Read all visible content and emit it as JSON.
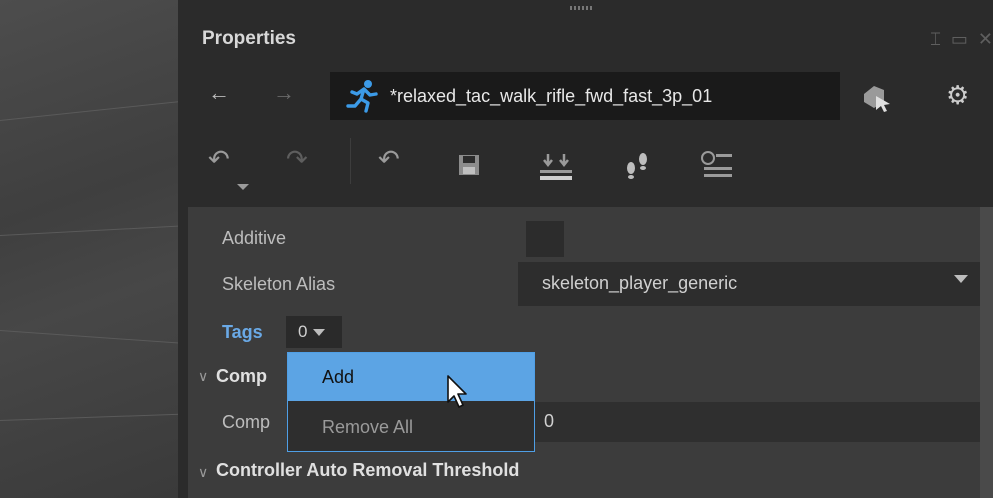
{
  "panel": {
    "title": "Properties",
    "window_controls": [
      "dock-icon",
      "maximize-icon",
      "close-icon"
    ]
  },
  "nav": {
    "back_icon": "arrow-left-icon",
    "forward_icon": "arrow-right-icon",
    "asset_icon": "running-figure-icon",
    "asset_name": "*relaxed_tac_walk_rifle_fwd_fast_3p_01",
    "tools": [
      "select-asset-icon",
      "settings-icon"
    ]
  },
  "toolbar": {
    "icons": [
      "undo-dropdown-icon",
      "redo-icon",
      "revert-icon",
      "save-icon",
      "import-icon",
      "footsteps-icon",
      "search-list-icon"
    ]
  },
  "properties": {
    "additive_label": "Additive",
    "additive_checked": false,
    "skeleton_alias_label": "Skeleton Alias",
    "skeleton_alias_value": "skeleton_player_generic",
    "tags_label": "Tags",
    "tags_count": "0",
    "section1_label": "Comp",
    "field1_label": "Comp",
    "field1_value": "0",
    "section2_label": "Controller Auto Removal Threshold"
  },
  "tags_menu": {
    "items": [
      {
        "label": "Add",
        "highlighted": true
      },
      {
        "label": "Remove All",
        "highlighted": false
      }
    ]
  },
  "colors": {
    "accent": "#5ca4e4",
    "tags_label": "#6aa9e6",
    "panel_bg": "#2b2b2b",
    "props_bg": "#3c3c3c"
  }
}
